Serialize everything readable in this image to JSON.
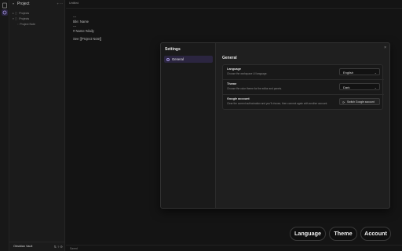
{
  "activity_bar": {
    "items": [
      {
        "icon": "files-icon"
      },
      {
        "icon": "settings-icon"
      }
    ]
  },
  "explorer": {
    "title": "Project",
    "tree": [
      {
        "label": "Projects",
        "glyph": "▸ ▢"
      },
      {
        "label": "Projects",
        "glyph": "▾ ▢"
      },
      {
        "label": "Project Note",
        "glyph": "▫"
      }
    ],
    "vault_name": "Obsidian Vault"
  },
  "editor": {
    "tab_title": "Untitled",
    "lines": [
      "---",
      "title: Name",
      "---",
      "# Name #daily",
      "",
      "See [[Project Note]]"
    ],
    "status": "Saved"
  },
  "settings_modal": {
    "title": "Settings",
    "nav": [
      {
        "label": "General",
        "active": true
      }
    ],
    "section_title": "General",
    "rows": {
      "language": {
        "label": "Language",
        "description": "Choose the workspace UI language.",
        "value": "English"
      },
      "theme": {
        "label": "Theme",
        "description": "Choose the color theme for the editor and panels.",
        "value": "Dark"
      },
      "google": {
        "label": "Google account",
        "description": "Clear the current authorization and you'll choose, then connect again with another account.",
        "button": "Switch Google account"
      }
    },
    "close_label": "×"
  },
  "actions": {
    "language": "Language",
    "theme": "Theme",
    "account": "Account"
  },
  "colors": {
    "accent": "#a596e0",
    "background": "#151515"
  }
}
